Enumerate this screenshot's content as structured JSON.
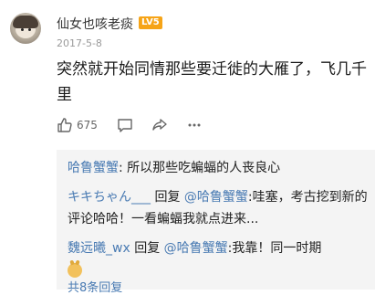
{
  "comment": {
    "username": "仙女也咳老痰",
    "level_badge": "LV5",
    "date": "2017-5-8",
    "text": "突然就开始同情那些要迁徙的大雁了，飞几千里",
    "like_count": "675",
    "icons": [
      "like-icon",
      "comment-icon",
      "share-icon",
      "more-icon"
    ],
    "badge_color": "#f6a417"
  },
  "replies": [
    {
      "name": "哈鲁蟹蟹",
      "reply_word": "",
      "target": "",
      "text": ": 所以那些吃蝙蝠的人丧良心"
    },
    {
      "name": "キキちゃん___",
      "reply_word": " 回复 ",
      "target": "@哈鲁蟹蟹",
      "text": ":哇塞，考古挖到新的评论哈哈！一看蝙蝠我就点进来..."
    },
    {
      "name": "魏远曦_wx",
      "reply_word": " 回复 ",
      "target": "@哈鲁蟹蟹",
      "text": ":我靠！同一时期"
    }
  ],
  "more_replies": "共8条回复",
  "link_color": "#4a7bb3"
}
